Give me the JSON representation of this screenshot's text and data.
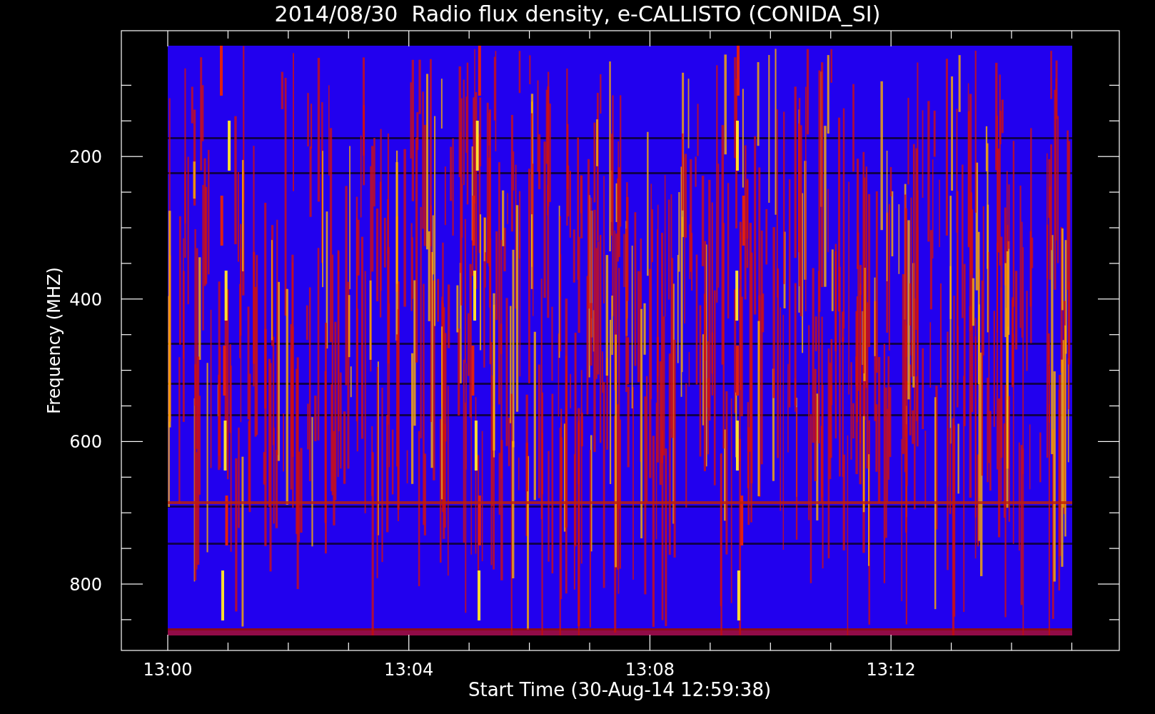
{
  "title": "2014/08/30  Radio flux density, e-CALLISTO (CONIDA_SI)",
  "y_axis": {
    "label": "Frequency (MHZ)",
    "ticks": [
      "200",
      "400",
      "600",
      "800"
    ]
  },
  "x_axis": {
    "label": "Start Time (30-Aug-14 12:59:38)",
    "ticks": [
      "13:00",
      "13:04",
      "13:08",
      "13:12"
    ]
  }
}
